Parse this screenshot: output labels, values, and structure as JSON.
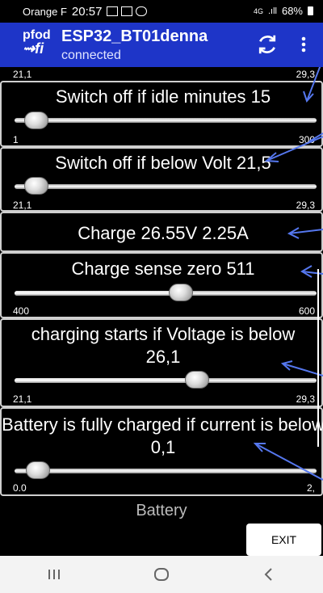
{
  "status_bar": {
    "carrier": "Orange F",
    "time": "20:57",
    "signal": "4G",
    "battery": "68%"
  },
  "app_bar": {
    "logo_line1": "pfod",
    "logo_line2": "fi",
    "title": "ESP32_BT01denna",
    "subtitle": "connected",
    "refresh_icon": "refresh-icon",
    "more_icon": "more-vert-icon"
  },
  "top_partial": {
    "min": "21,1",
    "max": "29,3"
  },
  "rows": [
    {
      "label": "Switch off if idle minutes 15",
      "min": "1",
      "max": "300",
      "value_fraction": 0.05
    },
    {
      "label": "Switch off if below Volt 21,5",
      "min": "21,1",
      "max": "29,3",
      "value_fraction": 0.05
    },
    {
      "label": "Charge 26.55V 2.25A"
    },
    {
      "label": "Charge sense zero 511",
      "min": "400",
      "max": "600",
      "value_fraction": 0.555
    },
    {
      "label": "charging starts if Voltage is below 26,1",
      "min": "21,1",
      "max": "29,3",
      "value_fraction": 0.61
    },
    {
      "label": "Battery is fully charged if current is below 0,1",
      "min": "0.0",
      "max": "2,",
      "value_fraction": 0.05
    }
  ],
  "bottom": {
    "battery_tab": "Battery",
    "exit_label": "EXIT"
  },
  "nav": {
    "recents_icon": "recents-icon",
    "home_icon": "home-icon",
    "back_icon": "back-icon"
  },
  "colors": {
    "appbar": "#1e35c8",
    "background": "#000000",
    "annotation_arrow": "#5577ee"
  }
}
